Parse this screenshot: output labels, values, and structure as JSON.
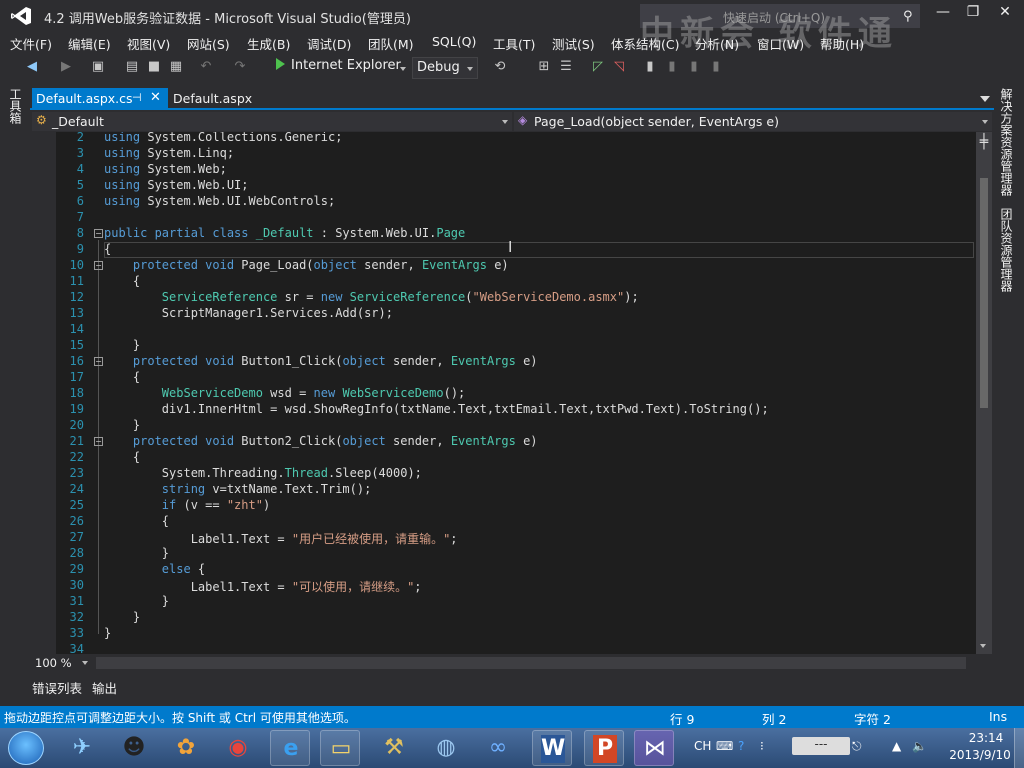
{
  "window": {
    "title": "4.2  调用Web服务验证数据 - Microsoft Visual Studio(管理员)",
    "quick_launch_placeholder": "快速启动 (Ctrl+Q)",
    "watermark": "中新会 软件通",
    "buttons": {
      "minimize": "—",
      "restore": "❐",
      "close": "✕"
    }
  },
  "menu": [
    "文件(F)",
    "编辑(E)",
    "视图(V)",
    "网站(S)",
    "生成(B)",
    "调试(D)",
    "团队(M)",
    "SQL(Q)",
    "工具(T)",
    "测试(S)",
    "体系结构(C)",
    "分析(N)",
    "窗口(W)",
    "帮助(H)"
  ],
  "toolbar": {
    "run_label": "Internet Explorer",
    "config": "Debug"
  },
  "side_tabs": {
    "left": "工具箱",
    "right": [
      "解决方案资源管理器",
      "团队资源管理器"
    ]
  },
  "tabs": [
    {
      "label": "Default.aspx.cs",
      "active": true
    },
    {
      "label": "Default.aspx",
      "active": false
    }
  ],
  "navbar": {
    "class": "_Default",
    "member": "Page_Load(object sender, EventArgs e)"
  },
  "editor": {
    "line_numbers": [
      "2",
      "3",
      "4",
      "5",
      "6",
      "7",
      "8",
      "9",
      "10",
      "11",
      "12",
      "13",
      "14",
      "15",
      "16",
      "17",
      "18",
      "19",
      "20",
      "21",
      "22",
      "23",
      "24",
      "25",
      "26",
      "27",
      "28",
      "29",
      "30",
      "31",
      "32",
      "33",
      "34"
    ],
    "zoom": "100 %"
  },
  "bottom_tabs": [
    "错误列表",
    "输出"
  ],
  "status": {
    "message": "拖动边距控点可调整边距大小。按 Shift 或 Ctrl 可使用其他选项。",
    "line": "行 9",
    "col": "列 2",
    "char": "字符 2",
    "mode": "Ins"
  },
  "taskbar": {
    "tray": {
      "lang": "CH",
      "time": "23:14",
      "date": "2013/9/10"
    }
  }
}
